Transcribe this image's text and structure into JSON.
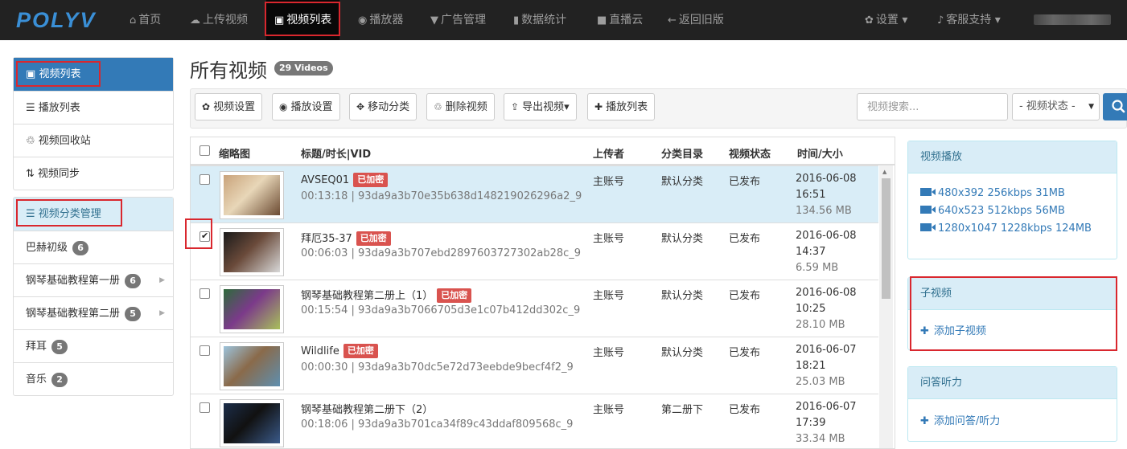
{
  "nav": {
    "logo": "POLYV",
    "items": [
      {
        "icon": "home-icon",
        "glyph": "⌂",
        "label": "首页"
      },
      {
        "icon": "upload-icon",
        "glyph": "☁",
        "label": "上传视频"
      },
      {
        "icon": "film-icon",
        "glyph": "▣",
        "label": "视频列表"
      },
      {
        "icon": "play-circle-icon",
        "glyph": "◉",
        "label": "播放器"
      },
      {
        "icon": "filter-icon",
        "glyph": "▼",
        "label": "广告管理"
      },
      {
        "icon": "bar-chart-icon",
        "glyph": "▮",
        "label": "数据统计"
      },
      {
        "icon": "video-camera-icon",
        "glyph": "■",
        "label": "直播云"
      },
      {
        "icon": "arrow-left-icon",
        "glyph": "←",
        "label": "返回旧版"
      }
    ],
    "settings": {
      "icon": "gear-icon",
      "glyph": "✿",
      "label": "设置 ▾"
    },
    "support": {
      "icon": "bell-icon",
      "glyph": "♪",
      "label": "客服支持 ▾"
    }
  },
  "sidebar": {
    "main": [
      {
        "icon": "film-icon",
        "glyph": "▣",
        "label": "视频列表"
      },
      {
        "icon": "list-icon",
        "glyph": "☰",
        "label": "播放列表"
      },
      {
        "icon": "trash-icon",
        "glyph": "♲",
        "label": "视频回收站"
      },
      {
        "icon": "sync-icon",
        "glyph": "⇅",
        "label": "视频同步"
      }
    ],
    "category_header": {
      "icon": "list-icon",
      "glyph": "☰",
      "label": "视频分类管理"
    },
    "categories": [
      {
        "label": "巴赫初级",
        "count": "6",
        "has_children": false
      },
      {
        "label": "钢琴基础教程第一册",
        "count": "6",
        "has_children": true
      },
      {
        "label": "钢琴基础教程第二册",
        "count": "5",
        "has_children": true
      },
      {
        "label": "拜耳",
        "count": "5",
        "has_children": false
      },
      {
        "label": "音乐",
        "count": "2",
        "has_children": false
      }
    ]
  },
  "page": {
    "title": "所有视频",
    "count_label": "29 Videos"
  },
  "toolbar": {
    "buttons": [
      {
        "icon": "gear-icon",
        "glyph": "✿",
        "label": "视频设置"
      },
      {
        "icon": "play-circle-icon",
        "glyph": "◉",
        "label": "播放设置"
      },
      {
        "icon": "move-icon",
        "glyph": "✥",
        "label": "移动分类"
      },
      {
        "icon": "trash-icon",
        "glyph": "♲",
        "label": "删除视频"
      },
      {
        "icon": "export-icon",
        "glyph": "⇪",
        "label": "导出视频▾"
      },
      {
        "icon": "plus-icon",
        "glyph": "✚",
        "label": "播放列表"
      }
    ],
    "search_placeholder": "视频搜索...",
    "status_select": "- 视频状态 -"
  },
  "table": {
    "headers": [
      "缩略图",
      "标题/时长|VID",
      "上传者",
      "分类目录",
      "视频状态",
      "时间/大小"
    ],
    "encrypted_label": "已加密",
    "rows": [
      {
        "title": "AVSEQ01",
        "encrypted": true,
        "duration_vid": "00:13:18 | 93da9a3b70e35b638d148219026296a2_9",
        "uploader": "主账号",
        "category": "默认分类",
        "status": "已发布",
        "date": "2016-06-08",
        "time": "16:51",
        "size": "134.56 MB",
        "checked": false,
        "selected": true,
        "thumb": [
          "#c9a27a",
          "#6b4a32",
          "#e8d7b8"
        ]
      },
      {
        "title": "拜厄35-37",
        "encrypted": true,
        "duration_vid": "00:06:03 | 93da9a3b707ebd2897603727302ab28c_9",
        "uploader": "主账号",
        "category": "默认分类",
        "status": "已发布",
        "date": "2016-06-08",
        "time": "14:37",
        "size": "6.59 MB",
        "checked": true,
        "selected": false,
        "thumb": [
          "#1a1a1a",
          "#d8d8d8",
          "#6a4a3a"
        ]
      },
      {
        "title": "钢琴基础教程第二册上（1）",
        "encrypted": true,
        "duration_vid": "00:15:54 | 93da9a3b7066705d3e1c07b412dd302c_9",
        "uploader": "主账号",
        "category": "默认分类",
        "status": "已发布",
        "date": "2016-06-08",
        "time": "10:25",
        "size": "28.10 MB",
        "checked": false,
        "selected": false,
        "thumb": [
          "#2d6b3a",
          "#a8c05a",
          "#7b3a8a"
        ]
      },
      {
        "title": "Wildlife",
        "encrypted": true,
        "duration_vid": "00:00:30 | 93da9a3b70dc5e72d73eebde9becf4f2_9",
        "uploader": "主账号",
        "category": "默认分类",
        "status": "已发布",
        "date": "2016-06-07",
        "time": "18:21",
        "size": "25.03 MB",
        "checked": false,
        "selected": false,
        "thumb": [
          "#9cc3dc",
          "#5e8fb0",
          "#8a6a4a"
        ]
      },
      {
        "title": "钢琴基础教程第二册下（2）",
        "encrypted": false,
        "duration_vid": "00:18:06 | 93da9a3b701ca34f89c43ddaf809568c_9",
        "uploader": "主账号",
        "category": "第二册下",
        "status": "已发布",
        "date": "2016-06-07",
        "time": "17:39",
        "size": "33.34 MB",
        "checked": false,
        "selected": false,
        "thumb": [
          "#1c2e4a",
          "#3a5a8a",
          "#111111"
        ]
      }
    ]
  },
  "panels": {
    "playback": {
      "title": "视频播放",
      "links": [
        "480x392 256kbps  31MB",
        "640x523 512kbps  56MB",
        "1280x1047 1228kbps  124MB"
      ]
    },
    "subvideo": {
      "title": "子视频",
      "link": "添加子视频"
    },
    "qa": {
      "title": "问答听力",
      "link": "添加问答/听力"
    }
  },
  "colors": {
    "nav_bg": "#222222",
    "primary": "#337ab7",
    "danger": "#d9534f",
    "highlight_box": "#d9272e",
    "info_bg": "#d9edf7"
  }
}
